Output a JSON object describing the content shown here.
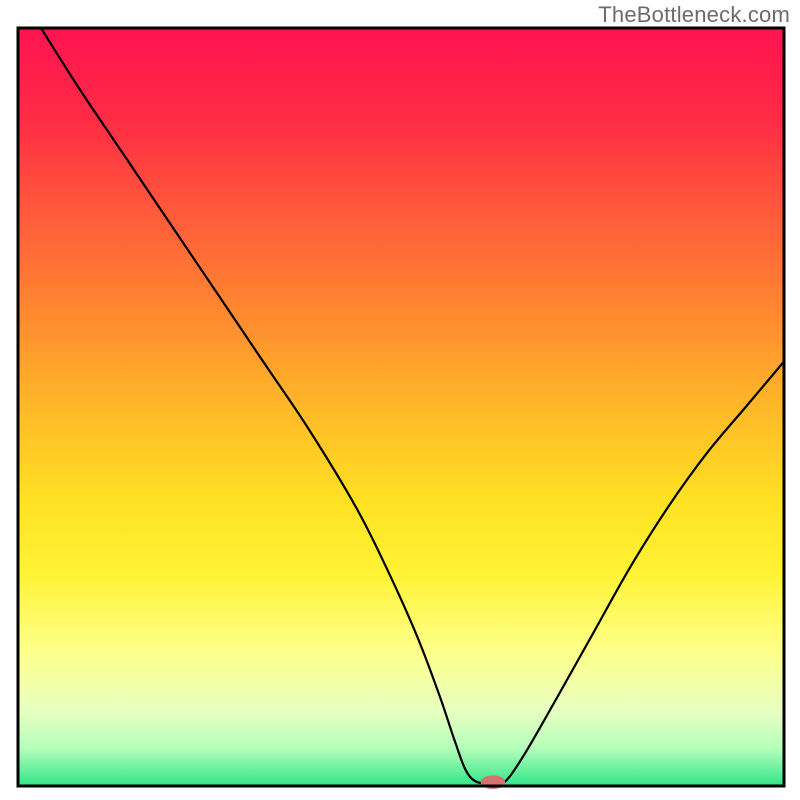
{
  "watermark": "TheBottleneck.com",
  "chart_data": {
    "type": "line",
    "title": "",
    "xlabel": "",
    "ylabel": "",
    "xlim": [
      0,
      100
    ],
    "ylim": [
      0,
      100
    ],
    "background": {
      "type": "vertical-gradient",
      "stops": [
        {
          "offset": 0.0,
          "color": "#ff1351"
        },
        {
          "offset": 0.12,
          "color": "#ff2b45"
        },
        {
          "offset": 0.25,
          "color": "#ff5c3a"
        },
        {
          "offset": 0.38,
          "color": "#ff8a2f"
        },
        {
          "offset": 0.5,
          "color": "#ffb828"
        },
        {
          "offset": 0.62,
          "color": "#ffe023"
        },
        {
          "offset": 0.72,
          "color": "#fff334"
        },
        {
          "offset": 0.82,
          "color": "#fdff88"
        },
        {
          "offset": 0.9,
          "color": "#e8ffc0"
        },
        {
          "offset": 0.95,
          "color": "#b4ffba"
        },
        {
          "offset": 1.0,
          "color": "#31e589"
        }
      ]
    },
    "series": [
      {
        "name": "bottleneck-curve",
        "color": "#000000",
        "width": 2.2,
        "x": [
          3.0,
          8.0,
          14.0,
          20.0,
          26.0,
          32.0,
          38.0,
          44.0,
          48.0,
          52.0,
          55.0,
          57.0,
          58.5,
          60.0,
          62.0,
          63.5,
          66.0,
          70.0,
          75.0,
          80.0,
          85.0,
          90.0,
          95.0,
          100.0
        ],
        "values": [
          100.0,
          92.0,
          83.0,
          74.0,
          65.0,
          56.0,
          47.0,
          37.0,
          29.0,
          20.0,
          12.0,
          6.0,
          2.0,
          0.5,
          0.5,
          0.5,
          4.0,
          11.0,
          20.0,
          29.0,
          37.0,
          44.0,
          50.0,
          56.0
        ]
      }
    ],
    "marker": {
      "name": "optimal-point",
      "x": 62.0,
      "y": 0.5,
      "color": "#d4746d",
      "rx": 1.6,
      "ry": 0.9
    },
    "plot_frame": {
      "stroke": "#000000",
      "width": 3
    }
  }
}
